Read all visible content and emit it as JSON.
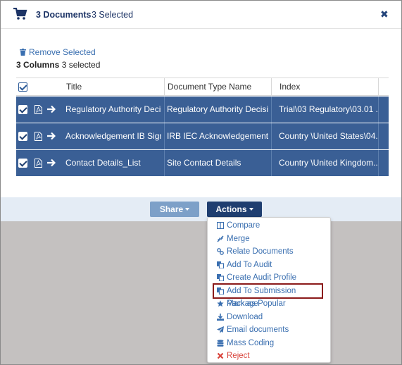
{
  "header": {
    "documents_label": "3 Documents",
    "selected_label": "3 Selected"
  },
  "remove_selected": "Remove Selected",
  "columns_info": {
    "bold": "3 Columns",
    "rest": "3 selected"
  },
  "grid": {
    "columns": [
      "Title",
      "Document Type Name",
      "Index"
    ],
    "rows": [
      {
        "title": "Regulatory Authority Deci...",
        "doc_type": "Regulatory Authority Decisi...",
        "index": "Trial\\03 Regulatory\\03.01 ..."
      },
      {
        "title": "Acknowledgement IB Sign...",
        "doc_type": "IRB IEC Acknowledgement ...",
        "index": "Country \\United States\\04..."
      },
      {
        "title": "Contact Details_List",
        "doc_type": "Site Contact Details",
        "index": "Country \\United Kingdom..."
      }
    ]
  },
  "toolbar": {
    "share_label": "Share",
    "actions_label": "Actions"
  },
  "actions_menu": [
    {
      "label": "Compare",
      "icon": "columns-icon"
    },
    {
      "label": "Merge",
      "icon": "compress-icon"
    },
    {
      "label": "Relate Documents",
      "icon": "link-icon"
    },
    {
      "label": "Add To Audit",
      "icon": "copy-icon"
    },
    {
      "label": "Create Audit Profile",
      "icon": "copy-icon"
    },
    {
      "label": "Add To Submission Package",
      "icon": "copy-icon",
      "highlighted": true
    },
    {
      "label": "Mark as Popular",
      "icon": "star-icon"
    },
    {
      "label": "Download",
      "icon": "download-icon"
    },
    {
      "label": "Email documents",
      "icon": "send-icon"
    },
    {
      "label": "Mass Coding",
      "icon": "database-icon"
    },
    {
      "label": "Reject",
      "icon": "times-icon",
      "danger": true
    }
  ],
  "colors": {
    "row_selected": "#3a5f95",
    "actions_button": "#1f3e70",
    "share_button": "#7da0c8",
    "link": "#3a6fb0",
    "danger": "#d9443c",
    "highlight_outline": "#8b1a1a"
  }
}
